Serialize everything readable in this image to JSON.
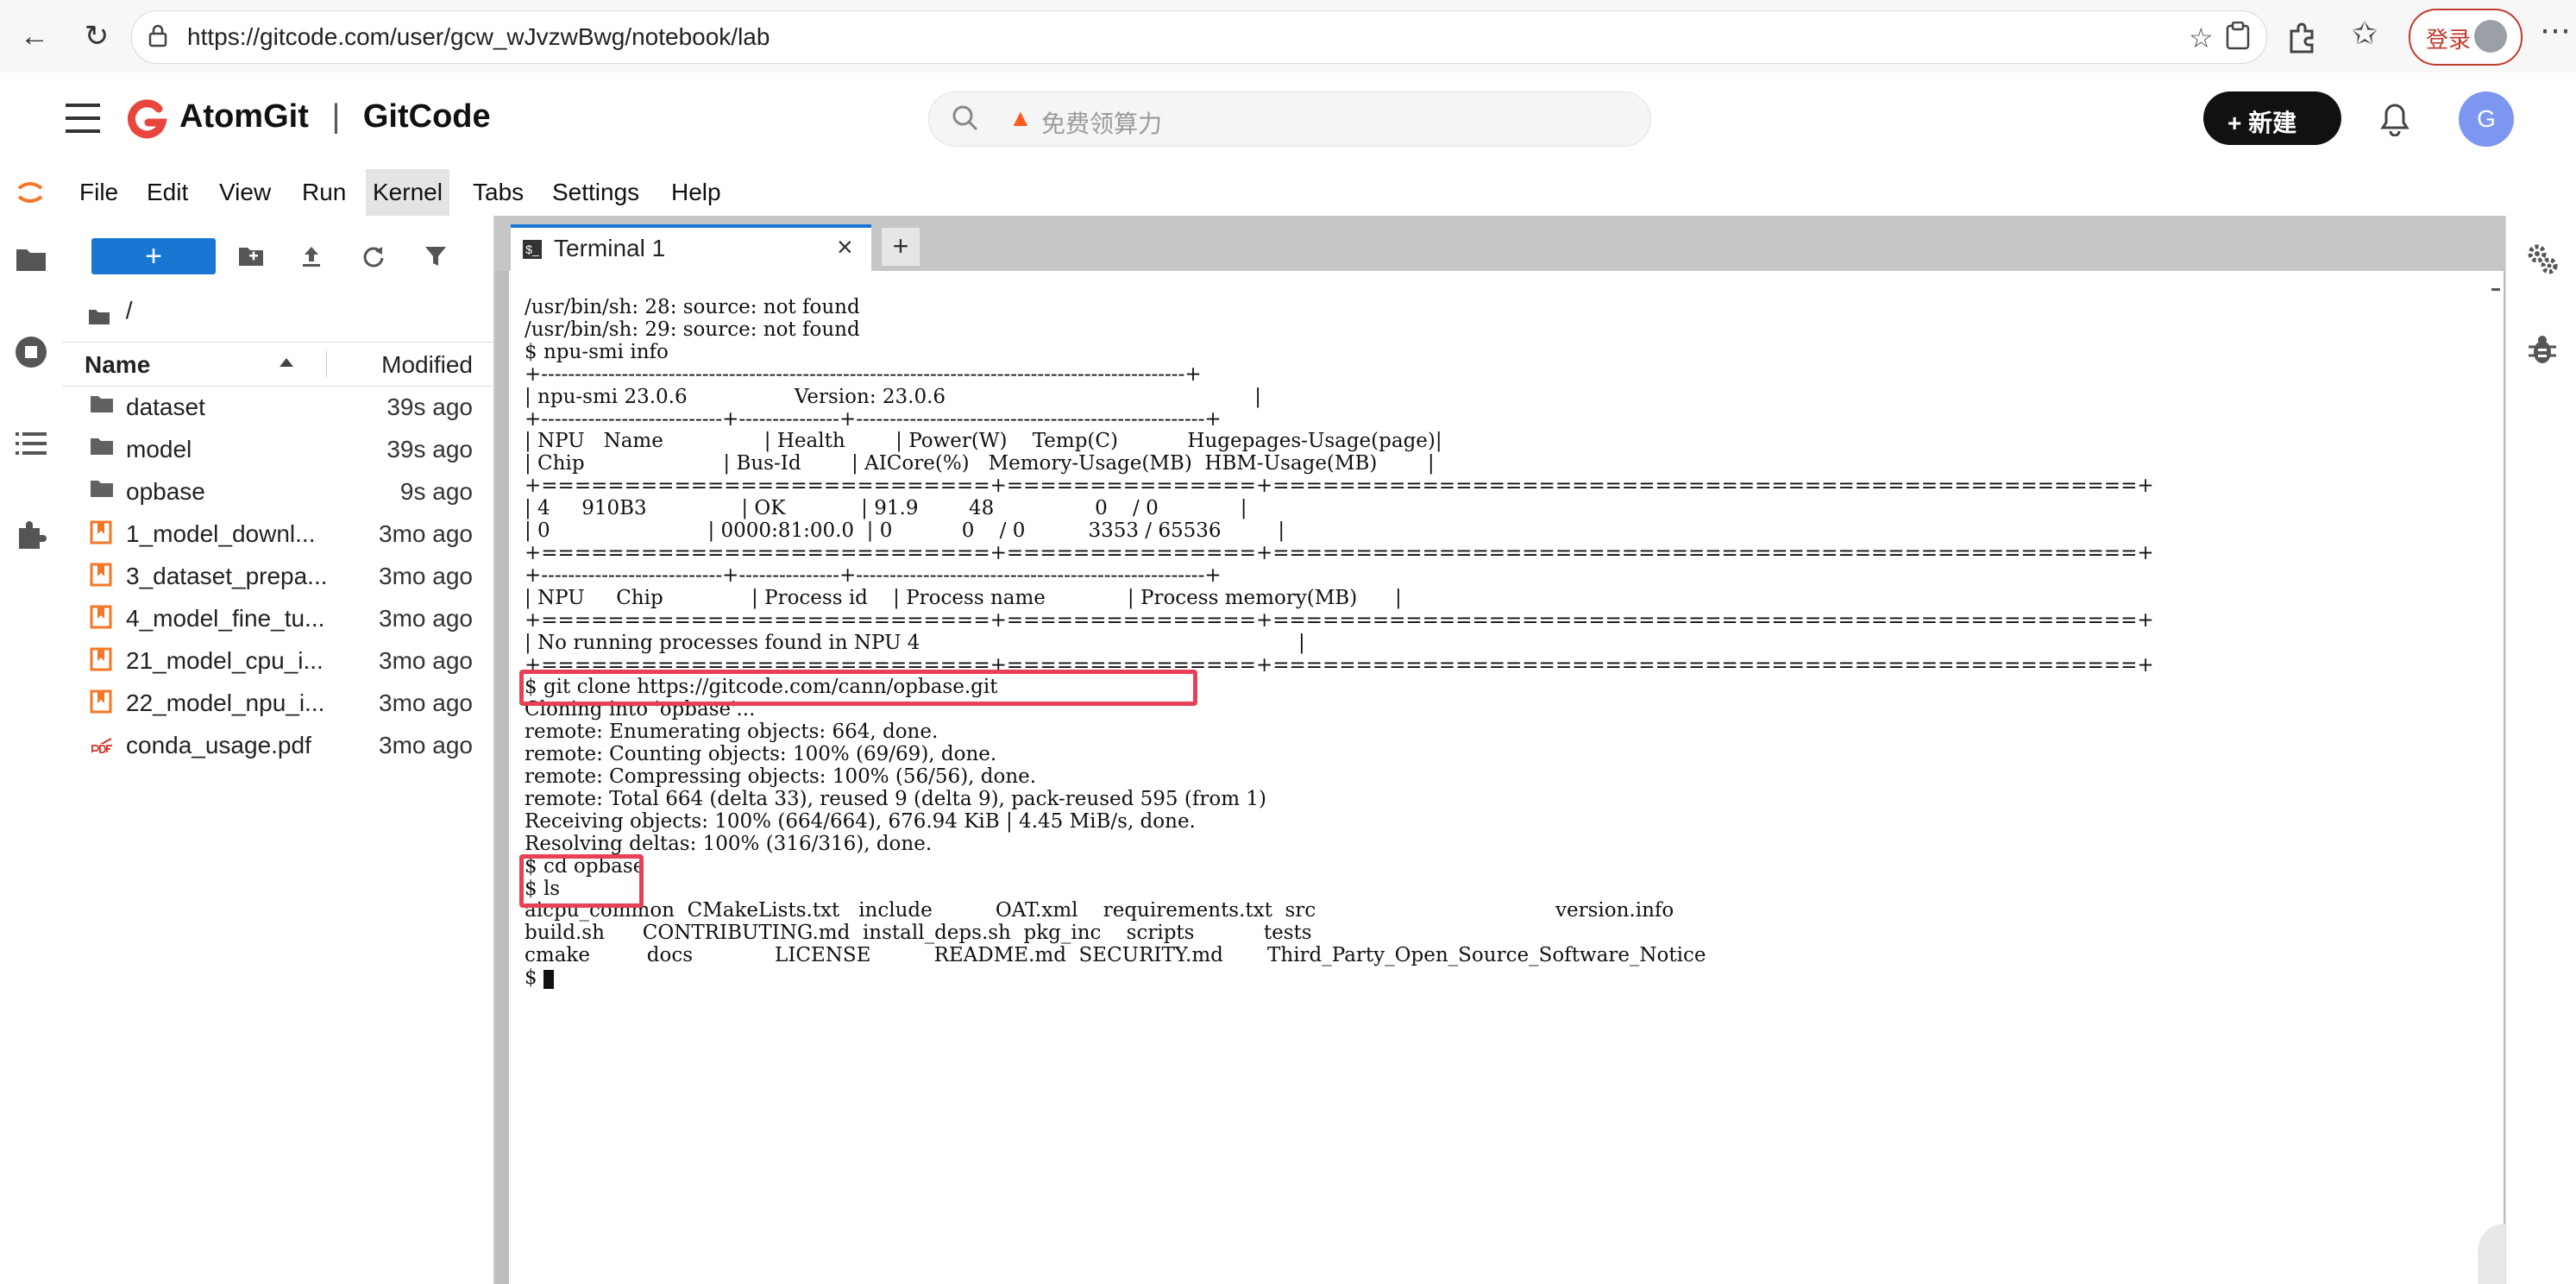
{
  "browser": {
    "url": "https://gitcode.com/user/gcw_wJvzwBwg/notebook/lab",
    "login_label": "登录"
  },
  "site": {
    "logo_primary": "AtomGit",
    "logo_separator": "|",
    "logo_secondary": "GitCode",
    "search_placeholder": "免费领算力",
    "new_button": "+ 新建",
    "avatar_initial": "G",
    "brand_color": "#e8453c"
  },
  "menu": {
    "items": [
      "File",
      "Edit",
      "View",
      "Run",
      "Kernel",
      "Tabs",
      "Settings",
      "Help"
    ],
    "active": "Kernel"
  },
  "file_browser": {
    "new_button": "+",
    "path": "/",
    "col_name": "Name",
    "col_modified": "Modified",
    "files": [
      {
        "name": "dataset",
        "modified": "39s ago",
        "type": "folder"
      },
      {
        "name": "model",
        "modified": "39s ago",
        "type": "folder"
      },
      {
        "name": "opbase",
        "modified": "9s ago",
        "type": "folder"
      },
      {
        "name": "1_model_downl...",
        "modified": "3mo ago",
        "type": "notebook"
      },
      {
        "name": "3_dataset_prepa...",
        "modified": "3mo ago",
        "type": "notebook"
      },
      {
        "name": "4_model_fine_tu...",
        "modified": "3mo ago",
        "type": "notebook"
      },
      {
        "name": "21_model_cpu_i...",
        "modified": "3mo ago",
        "type": "notebook"
      },
      {
        "name": "22_model_npu_i...",
        "modified": "3mo ago",
        "type": "notebook"
      },
      {
        "name": "conda_usage.pdf",
        "modified": "3mo ago",
        "type": "pdf"
      }
    ]
  },
  "tabs": {
    "terminal_title": "Terminal 1",
    "add_label": "+"
  },
  "terminal": {
    "lines": [
      "/usr/bin/sh: 28: source: not found",
      "/usr/bin/sh: 29: source: not found",
      "$ npu-smi info",
      "+------------------------------------------------------------------------------------------------+",
      "| npu-smi 23.0.6                 Version: 23.0.6                                                 |",
      "+---------------------------+---------------+----------------------------------------------------+",
      "| NPU   Name                | Health        | Power(W)    Temp(C)           Hugepages-Usage(page)|",
      "| Chip                      | Bus-Id        | AICore(%)   Memory-Usage(MB)  HBM-Usage(MB)        |",
      "+===========================+===============+====================================================+",
      "| 4     910B3               | OK            | 91.9        48                0    / 0             |",
      "| 0                         | 0000:81:00.0  | 0           0    / 0          3353 / 65536         |",
      "+===========================+===============+====================================================+",
      "+---------------------------+---------------+----------------------------------------------------+",
      "| NPU     Chip              | Process id    | Process name             | Process memory(MB)      |",
      "+===========================+===============+====================================================+",
      "| No running processes found in NPU 4                                                            |",
      "+===========================+===============+====================================================+",
      "$ git clone https://gitcode.com/cann/opbase.git",
      "Cloning into 'opbase'...",
      "remote: Enumerating objects: 664, done.",
      "remote: Counting objects: 100% (69/69), done.",
      "remote: Compressing objects: 100% (56/56), done.",
      "remote: Total 664 (delta 33), reused 9 (delta 9), pack-reused 595 (from 1)",
      "Receiving objects: 100% (664/664), 676.94 KiB | 4.45 MiB/s, done.",
      "Resolving deltas: 100% (316/316), done.",
      "$ cd opbase",
      "$ ls",
      "aicpu_common  CMakeLists.txt   include          OAT.xml    requirements.txt  src                                      version.info",
      "build.sh      CONTRIBUTING.md  install_deps.sh  pkg_inc    scripts           tests",
      "cmake         docs             LICENSE          README.md  SECURITY.md       Third_Party_Open_Source_Software_Notice",
      "$ "
    ]
  }
}
